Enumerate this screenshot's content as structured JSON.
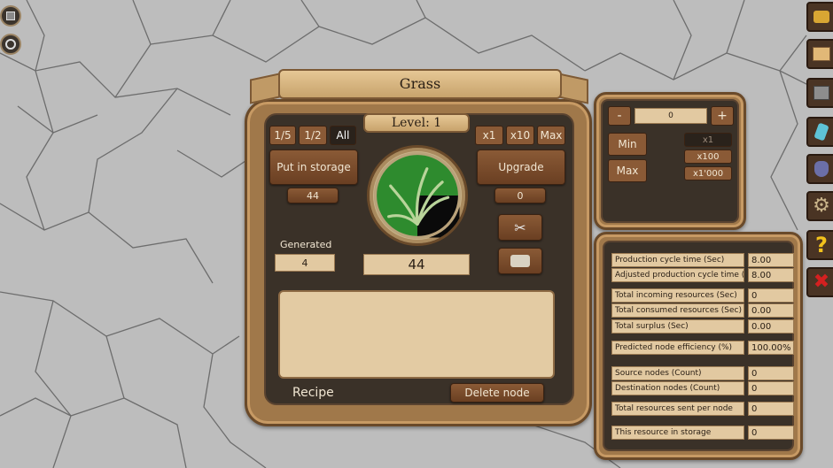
{
  "panel_title": "Grass",
  "level_label": "Level: 1",
  "fraction_buttons": [
    "1/5",
    "1/2",
    "All"
  ],
  "multiplier_buttons": [
    "x1",
    "x10",
    "Max"
  ],
  "put_in_storage_label": "Put in storage",
  "storage_amount": "44",
  "upgrade_label": "Upgrade",
  "upgrade_amount": "0",
  "generated_label": "Generated",
  "generated_value": "4",
  "resource_count": "44",
  "recipe_label": "Recipe",
  "delete_node_label": "Delete node",
  "side_panel": {
    "minus_label": "-",
    "plus_label": "+",
    "amount_value": "0",
    "min_label": "Min",
    "max_label": "Max",
    "multipliers": [
      "x1",
      "x100",
      "x1'000"
    ]
  },
  "stats": [
    {
      "label": "Production cycle time (Sec)",
      "value": "8.00"
    },
    {
      "label": "Adjusted production cycle time (Sec)",
      "value": "8.00"
    },
    {
      "label": "Total incoming resources (Sec)",
      "value": "0"
    },
    {
      "label": "Total consumed resources (Sec)",
      "value": "0.00"
    },
    {
      "label": "Total surplus (Sec)",
      "value": "0.00"
    },
    {
      "label": "Predicted node efficiency (%)",
      "value": "100.00%"
    },
    {
      "label": "Source nodes (Count)",
      "value": "0"
    },
    {
      "label": "Destination nodes (Count)",
      "value": "0"
    },
    {
      "label": "Total resources sent per node",
      "value": "0"
    },
    {
      "label": "This resource in storage",
      "value": "0"
    }
  ],
  "toolbar_icons": [
    "coins-icon",
    "book-icon",
    "stone-block-icon",
    "crystal-icon",
    "potion-bag-icon",
    "gear-icon",
    "help-icon",
    "close-icon"
  ],
  "left_icons": [
    "box-icon",
    "clock-icon"
  ],
  "colors": {
    "wood": "#a0784a",
    "dark_panel": "#3a3128",
    "plank": "#7a4a2a",
    "parchment": "#e2c9a1",
    "grass_green": "#2e8b2e",
    "close_red": "#d42020",
    "help_yellow": "#f2c21c"
  }
}
